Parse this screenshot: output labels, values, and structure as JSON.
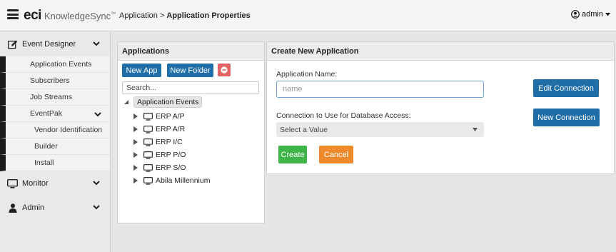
{
  "header": {
    "logo_brand": "eci",
    "logo_product": "KnowledgeSync",
    "logo_tm": "™",
    "breadcrumb_parent": "Application",
    "breadcrumb_separator": ">",
    "breadcrumb_current": "Application Properties",
    "username": "admin"
  },
  "sidebar": {
    "event_designer": "Event Designer",
    "event_designer_items": [
      "Application Events",
      "Subscribers",
      "Job Streams"
    ],
    "eventpak": "EventPak",
    "eventpak_items": [
      "Vendor Identification",
      "Builder",
      "Install"
    ],
    "monitor": "Monitor",
    "admin": "Admin"
  },
  "applications": {
    "title": "Applications",
    "new_app_label": "New App",
    "new_folder_label": "New Folder",
    "search_placeholder": "Search...",
    "tree_root": "Application Events",
    "tree_items": [
      "ERP A/P",
      "ERP A/R",
      "ERP I/C",
      "ERP P/O",
      "ERP S/O",
      "Abila Millennium"
    ]
  },
  "create": {
    "title": "Create New Application",
    "name_label": "Application Name:",
    "name_placeholder": "name",
    "name_value": "",
    "connection_label": "Connection to Use for Database Access:",
    "connection_selected": "Select a Value",
    "edit_connection_label": "Edit Connection",
    "new_connection_label": "New Connection",
    "create_label": "Create",
    "cancel_label": "Cancel"
  },
  "colors": {
    "primary": "#1f6ea8",
    "danger": "#e36464",
    "success": "#3fb549",
    "warning": "#ef8a2c"
  },
  "icons": [
    "menu-icon",
    "user-icon",
    "edit-icon",
    "chevron-down-icon",
    "monitor-icon",
    "person-icon",
    "minus-icon",
    "caret-right-icon",
    "caret-down-icon"
  ]
}
